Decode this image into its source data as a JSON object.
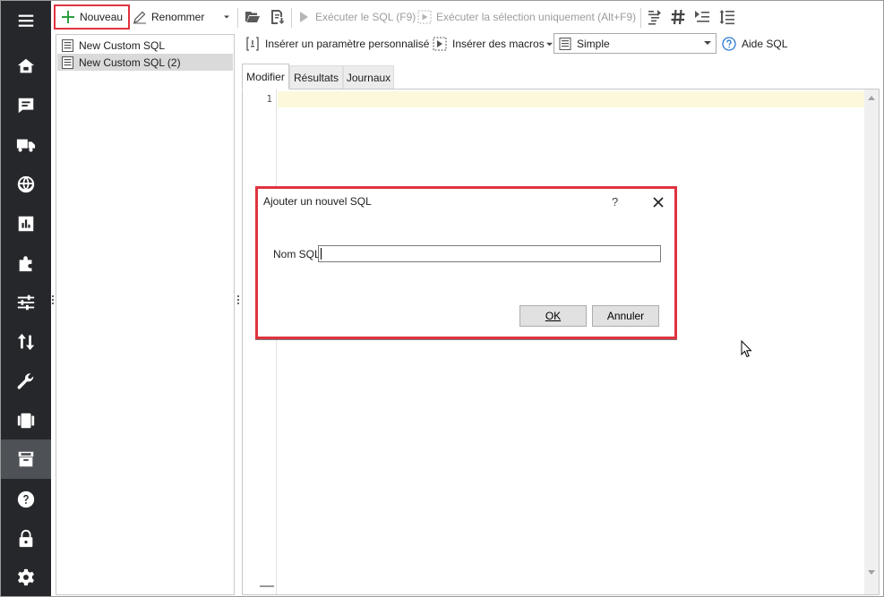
{
  "toolbar": {
    "new_label": "Nouveau",
    "rename_label": "Renommer",
    "run_label": "Exécuter le SQL (F9)",
    "run_selection_label": "Exécuter la sélection uniquement (Alt+F9)"
  },
  "toolbar2": {
    "insert_param_label": "Insérer un paramètre personnalisé",
    "insert_macros_label": "Insérer des macros",
    "mode_value": "Simple",
    "help_label": "Aide SQL"
  },
  "sql_list": {
    "items": [
      {
        "label": "New Custom SQL",
        "selected": false
      },
      {
        "label": "New Custom SQL (2)",
        "selected": true
      }
    ]
  },
  "tabs": [
    {
      "label": "Modifier",
      "active": true
    },
    {
      "label": "Résultats",
      "active": false
    },
    {
      "label": "Journaux",
      "active": false
    }
  ],
  "editor": {
    "line_numbers": [
      "1"
    ]
  },
  "dialog": {
    "title": "Ajouter un nouvel SQL",
    "help_glyph": "?",
    "name_label": "Nom SQL",
    "name_value": "",
    "ok_label": "OK",
    "cancel_label": "Annuler"
  },
  "sidebar": {
    "items": [
      {
        "icon": "menu-icon"
      },
      {
        "icon": "home-icon"
      },
      {
        "icon": "message-icon"
      },
      {
        "icon": "truck-icon"
      },
      {
        "icon": "globe-icon"
      },
      {
        "icon": "chart-icon"
      },
      {
        "icon": "puzzle-icon"
      },
      {
        "icon": "sliders-icon"
      },
      {
        "icon": "transfer-icon"
      },
      {
        "icon": "wrench-icon"
      },
      {
        "icon": "film-icon"
      },
      {
        "icon": "archive-icon",
        "active": true
      },
      {
        "icon": "help-icon"
      },
      {
        "icon": "lock-icon"
      },
      {
        "icon": "gear-icon"
      }
    ]
  },
  "colors": {
    "highlight": "#e0333d",
    "rail": "#25272b",
    "rail_active": "#4e5156",
    "new_plus": "#2e9e3e",
    "help_blue": "#2a78d4"
  }
}
